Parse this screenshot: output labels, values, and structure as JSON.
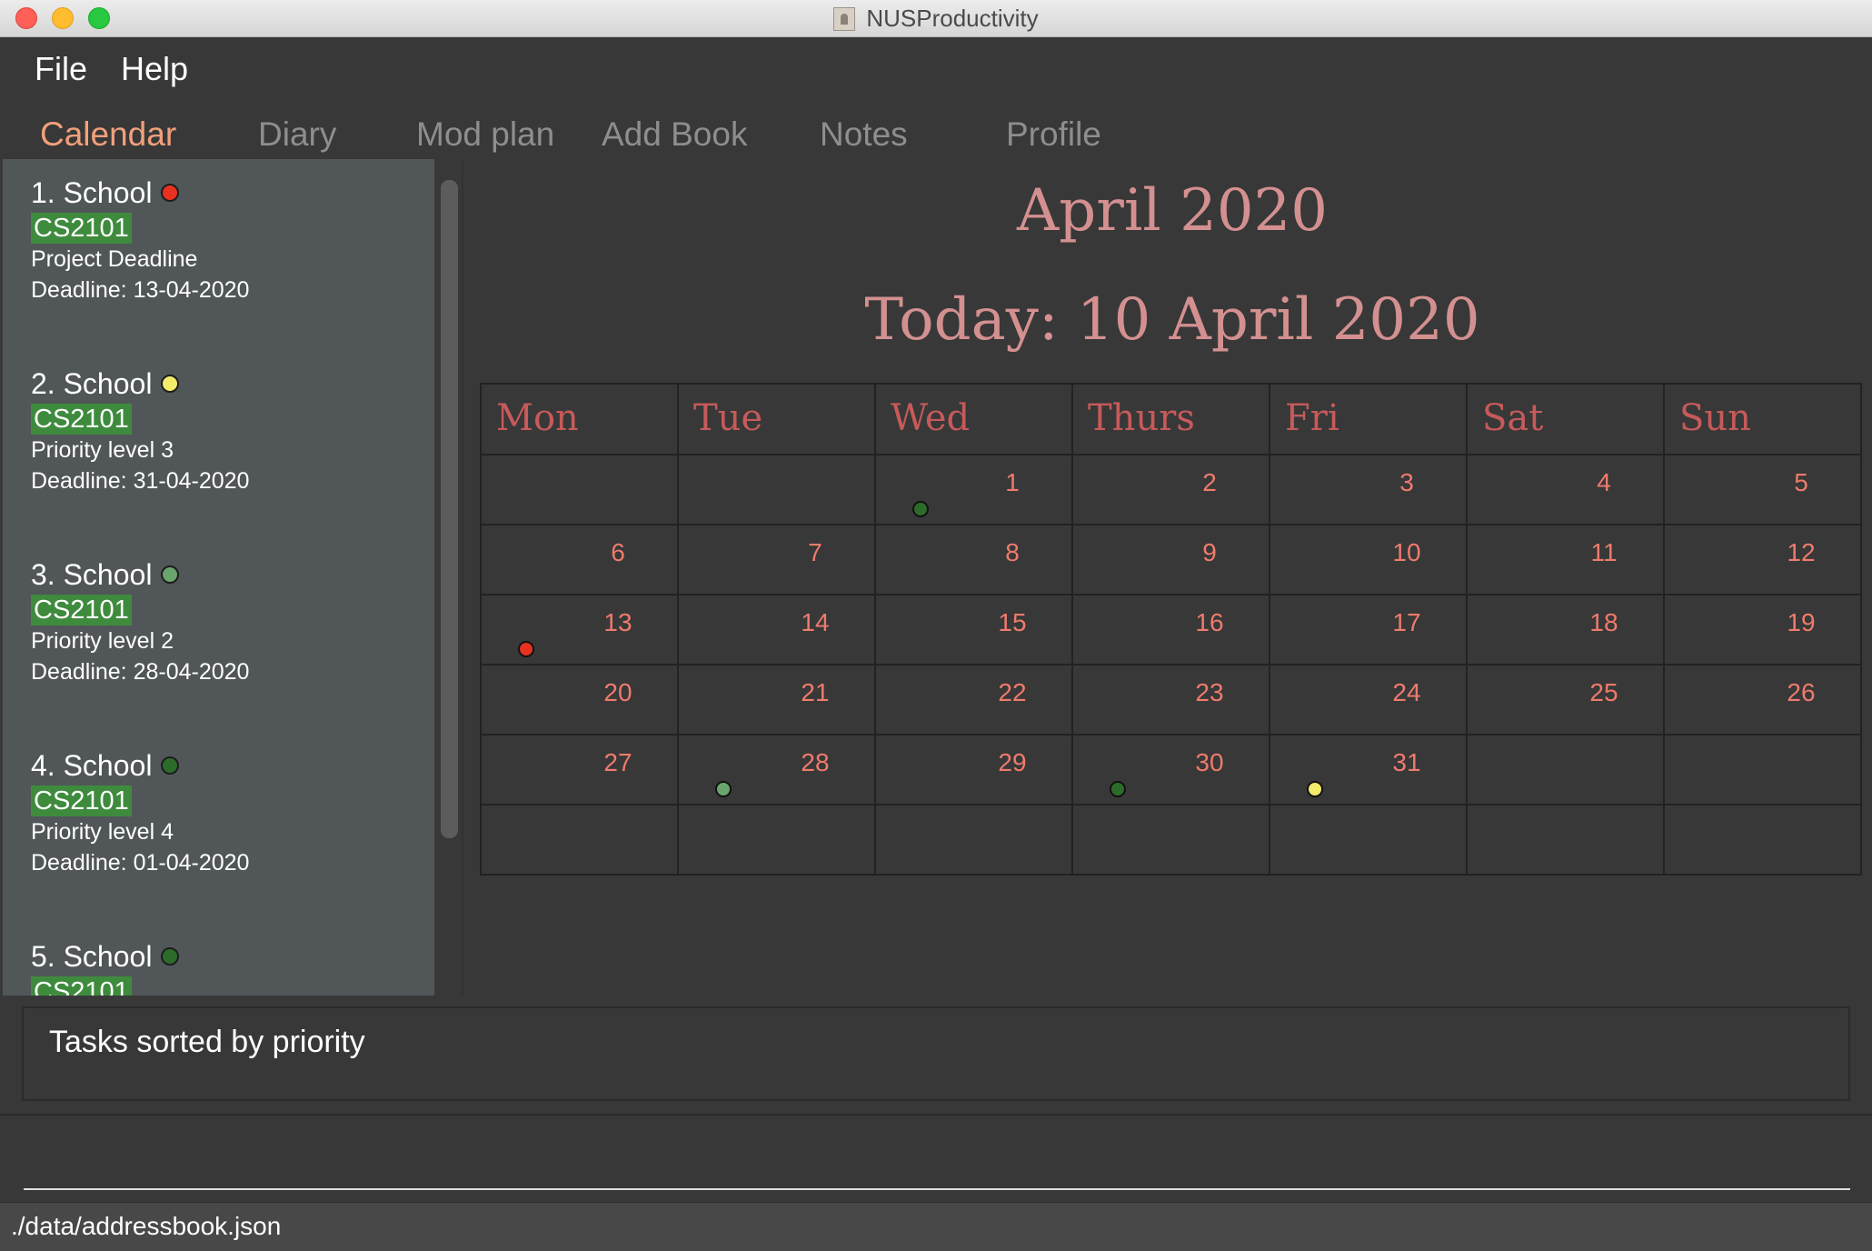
{
  "window": {
    "title": "NUSProductivity"
  },
  "menu": {
    "items": [
      "File",
      "Help"
    ]
  },
  "tabs": [
    {
      "label": "Calendar",
      "active": true
    },
    {
      "label": "Diary",
      "active": false
    },
    {
      "label": "Mod plan",
      "active": false
    },
    {
      "label": "Add Book",
      "active": false
    },
    {
      "label": "Notes",
      "active": false
    },
    {
      "label": "Profile",
      "active": false
    }
  ],
  "tasks": [
    {
      "index": "1.",
      "category": "School",
      "status_color": "#e8311f",
      "tag": "CS2101",
      "lines": [
        "Project Deadline",
        "Deadline: 13-04-2020"
      ]
    },
    {
      "index": "2.",
      "category": "School",
      "status_color": "#f3eb6a",
      "tag": "CS2101",
      "lines": [
        "Priority level 3",
        "Deadline: 31-04-2020"
      ]
    },
    {
      "index": "3.",
      "category": "School",
      "status_color": "#6aa56e",
      "tag": "CS2101",
      "lines": [
        "Priority level 2",
        "Deadline: 28-04-2020"
      ]
    },
    {
      "index": "4.",
      "category": "School",
      "status_color": "#2c6b2a",
      "tag": "CS2101",
      "lines": [
        "Priority level 4",
        "Deadline: 01-04-2020"
      ]
    },
    {
      "index": "5.",
      "category": "School",
      "status_color": "#2c6b2a",
      "tag": "CS2101",
      "lines": []
    }
  ],
  "calendar": {
    "month_title": "April 2020",
    "today_label": "Today: 10 April 2020",
    "day_names": [
      "Mon",
      "Tue",
      "Wed",
      "Thurs",
      "Fri",
      "Sat",
      "Sun"
    ],
    "weeks": [
      [
        "",
        "",
        "1",
        "2",
        "3",
        "4",
        "5"
      ],
      [
        "6",
        "7",
        "8",
        "9",
        "10",
        "11",
        "12"
      ],
      [
        "13",
        "14",
        "15",
        "16",
        "17",
        "18",
        "19"
      ],
      [
        "20",
        "21",
        "22",
        "23",
        "24",
        "25",
        "26"
      ],
      [
        "27",
        "28",
        "29",
        "30",
        "31",
        "",
        ""
      ],
      [
        "",
        "",
        "",
        "",
        "",
        "",
        ""
      ]
    ],
    "events": [
      {
        "day": "1",
        "color": "#2c6b2a"
      },
      {
        "day": "13",
        "color": "#e8311f"
      },
      {
        "day": "28",
        "color": "#6aa56e"
      },
      {
        "day": "30",
        "color": "#2c6b2a"
      },
      {
        "day": "31",
        "color": "#f3eb6a"
      }
    ]
  },
  "result_display": {
    "text": "Tasks sorted by priority"
  },
  "command_box": {
    "value": ""
  },
  "status_bar": {
    "path": "./data/addressbook.json"
  }
}
